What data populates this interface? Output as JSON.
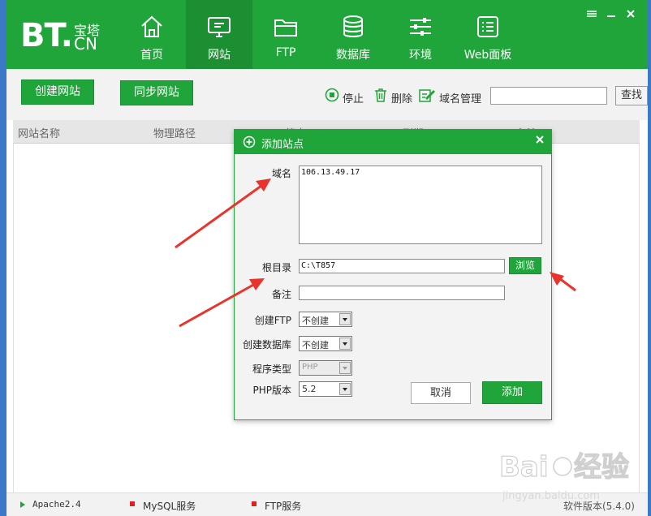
{
  "logo": {
    "bt": "BT.",
    "cn_top": "宝塔",
    "cn_bottom": "CN"
  },
  "nav": [
    {
      "label": "首页",
      "icon": "home-icon"
    },
    {
      "label": "网站",
      "icon": "monitor-icon",
      "active": true
    },
    {
      "label": "FTP",
      "icon": "folder-icon"
    },
    {
      "label": "数据库",
      "icon": "database-icon"
    },
    {
      "label": "环境",
      "icon": "sliders-icon"
    },
    {
      "label": "Web面板",
      "icon": "list-panel-icon"
    }
  ],
  "window_controls": [
    "menu-icon",
    "minimize-icon",
    "close-icon"
  ],
  "toolbar": {
    "create_site": "创建网站",
    "sync_site": "同步网站",
    "stop": "停止",
    "delete": "删除",
    "domain_manage": "域名管理",
    "search_value": "",
    "search_btn": "查找"
  },
  "table": {
    "headers": [
      "网站名称",
      "物理路径",
      "状态",
      "到期",
      "备注"
    ]
  },
  "dialog": {
    "title": "添加站点",
    "domain_label": "域名",
    "domain_value": "106.13.49.17",
    "root_label": "根目录",
    "root_value": "C:\\T857",
    "browse": "浏览",
    "note_label": "备注",
    "note_value": "",
    "ftp_label": "创建FTP",
    "ftp_value": "不创建",
    "db_label": "创建数据库",
    "db_value": "不创建",
    "prog_label": "程序类型",
    "prog_value": "PHP",
    "php_label": "PHP版本",
    "php_value": "5.2",
    "cancel": "取消",
    "add": "添加"
  },
  "status": {
    "apache": "Apache2.4",
    "mysql": "MySQL服务",
    "ftp": "FTP服务",
    "version": "软件版本(5.4.0)"
  },
  "colors": {
    "brand": "#20a53a",
    "frame": "#3c78c8",
    "arrow": "#e8342c"
  }
}
